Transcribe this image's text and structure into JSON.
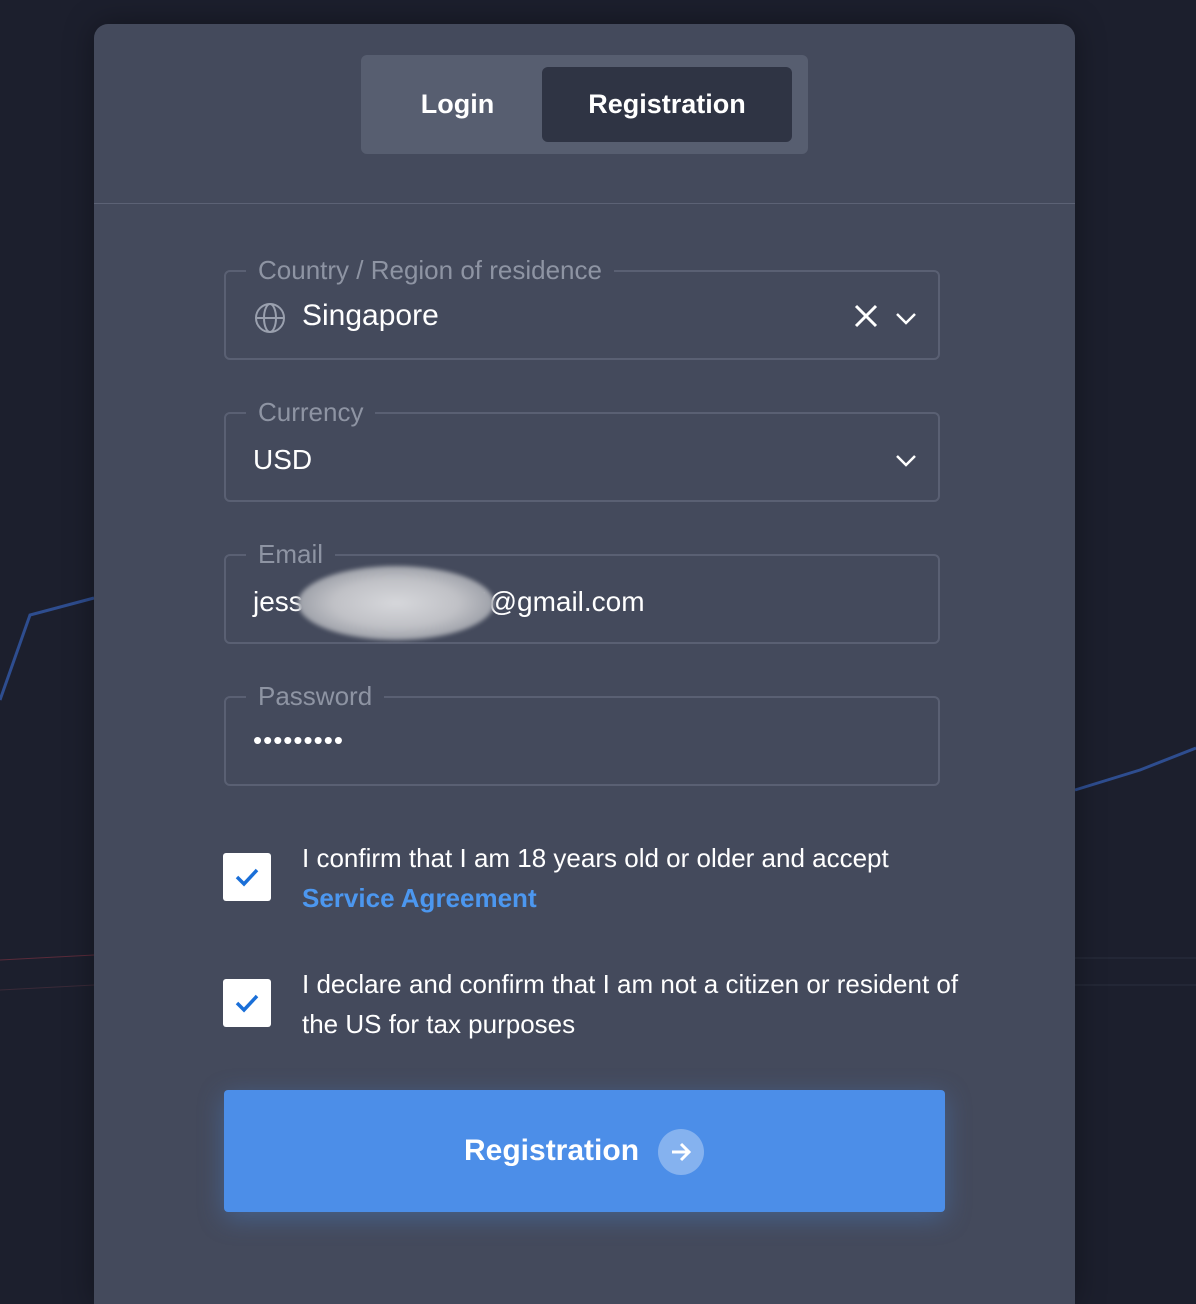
{
  "tabs": {
    "login": "Login",
    "registration": "Registration",
    "active": "registration"
  },
  "form": {
    "country": {
      "label": "Country / Region of residence",
      "value": "Singapore",
      "icon": "globe-icon"
    },
    "currency": {
      "label": "Currency",
      "value": "USD"
    },
    "email": {
      "label": "Email",
      "value_start": "jess",
      "value_end": "4@gmail.com"
    },
    "password": {
      "label": "Password",
      "value_masked": "•••••••••"
    }
  },
  "checkboxes": [
    {
      "checked": true,
      "text": "I confirm that I am 18 years old or older and accept",
      "link": "Service Agreement"
    },
    {
      "checked": true,
      "text": "I declare and confirm that I am not a citizen or resident of the US for tax purposes"
    }
  ],
  "submit": {
    "label": "Registration",
    "icon": "arrow-right-icon"
  },
  "colors": {
    "accent": "#4c8ee8",
    "link": "#4c97ef",
    "card": "#444a5c",
    "background": "#1c1f2d"
  }
}
